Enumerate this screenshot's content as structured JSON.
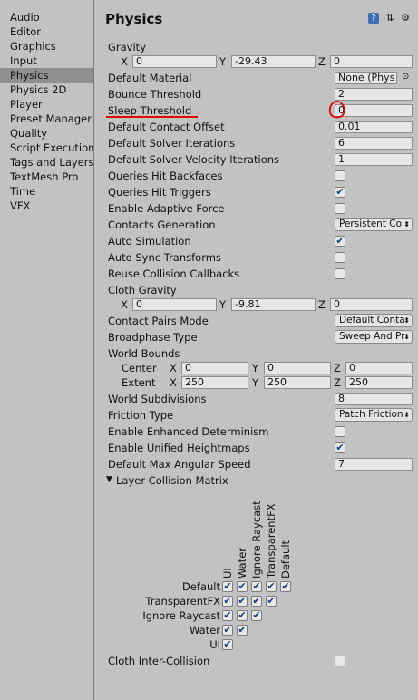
{
  "sidebar": {
    "items": [
      "Audio",
      "Editor",
      "Graphics",
      "Input",
      "Physics",
      "Physics 2D",
      "Player",
      "Preset Manager",
      "Quality",
      "Script Execution Order",
      "Tags and Layers",
      "TextMesh Pro",
      "Time",
      "VFX"
    ],
    "active": "Physics"
  },
  "header": {
    "title": "Physics",
    "help_icon": "help-book-icon",
    "presets_icon": "presets-icon",
    "settings_icon": "gear-icon"
  },
  "gravity": {
    "label": "Gravity",
    "x_label": "X",
    "x": "0",
    "y_label": "Y",
    "y": "-29.43",
    "z_label": "Z",
    "z": "0"
  },
  "default_material": {
    "label": "Default Material",
    "value": "None (Phys"
  },
  "bounce_threshold": {
    "label": "Bounce Threshold",
    "value": "2"
  },
  "sleep_threshold": {
    "label": "Sleep Threshold",
    "value": "0"
  },
  "default_contact_offset": {
    "label": "Default Contact Offset",
    "value": "0.01"
  },
  "default_solver_iterations": {
    "label": "Default Solver Iterations",
    "value": "6"
  },
  "default_solver_velocity_iterations": {
    "label": "Default Solver Velocity Iterations",
    "value": "1"
  },
  "queries_hit_backfaces": {
    "label": "Queries Hit Backfaces",
    "checked": false
  },
  "queries_hit_triggers": {
    "label": "Queries Hit Triggers",
    "checked": true
  },
  "enable_adaptive_force": {
    "label": "Enable Adaptive Force",
    "checked": false
  },
  "contacts_generation": {
    "label": "Contacts Generation",
    "value": "Persistent Co"
  },
  "auto_simulation": {
    "label": "Auto Simulation",
    "checked": true
  },
  "auto_sync_transforms": {
    "label": "Auto Sync Transforms",
    "checked": false
  },
  "reuse_collision_callbacks": {
    "label": "Reuse Collision Callbacks",
    "checked": false
  },
  "cloth_gravity": {
    "label": "Cloth Gravity",
    "x_label": "X",
    "x": "0",
    "y_label": "Y",
    "y": "-9.81",
    "z_label": "Z",
    "z": "0"
  },
  "contact_pairs_mode": {
    "label": "Contact Pairs Mode",
    "value": "Default Conta"
  },
  "broadphase_type": {
    "label": "Broadphase Type",
    "value": "Sweep And Pr"
  },
  "world_bounds": {
    "label": "World Bounds",
    "center": {
      "label": "Center",
      "x_label": "X",
      "x": "0",
      "y_label": "Y",
      "y": "0",
      "z_label": "Z",
      "z": "0"
    },
    "extent": {
      "label": "Extent",
      "x_label": "X",
      "x": "250",
      "y_label": "Y",
      "y": "250",
      "z_label": "Z",
      "z": "250"
    }
  },
  "world_subdivisions": {
    "label": "World Subdivisions",
    "value": "8"
  },
  "friction_type": {
    "label": "Friction Type",
    "value": "Patch Friction"
  },
  "enable_enhanced_determinism": {
    "label": "Enable Enhanced Determinism",
    "checked": false
  },
  "enable_unified_heightmaps": {
    "label": "Enable Unified Heightmaps",
    "checked": true
  },
  "default_max_angular_speed": {
    "label": "Default Max Angular Speed",
    "value": "7"
  },
  "layer_collision_matrix": {
    "label": "Layer Collision Matrix",
    "columns": [
      "UI",
      "Water",
      "Ignore Raycast",
      "TransparentFX",
      "Default"
    ],
    "rows": [
      "Default",
      "TransparentFX",
      "Ignore Raycast",
      "Water",
      "UI"
    ]
  },
  "cloth_inter_collision": {
    "label": "Cloth Inter-Collision",
    "checked": false
  },
  "check_glyph": "✔",
  "dropdown_arrow": "⬍",
  "annotation_color": "#e00000"
}
